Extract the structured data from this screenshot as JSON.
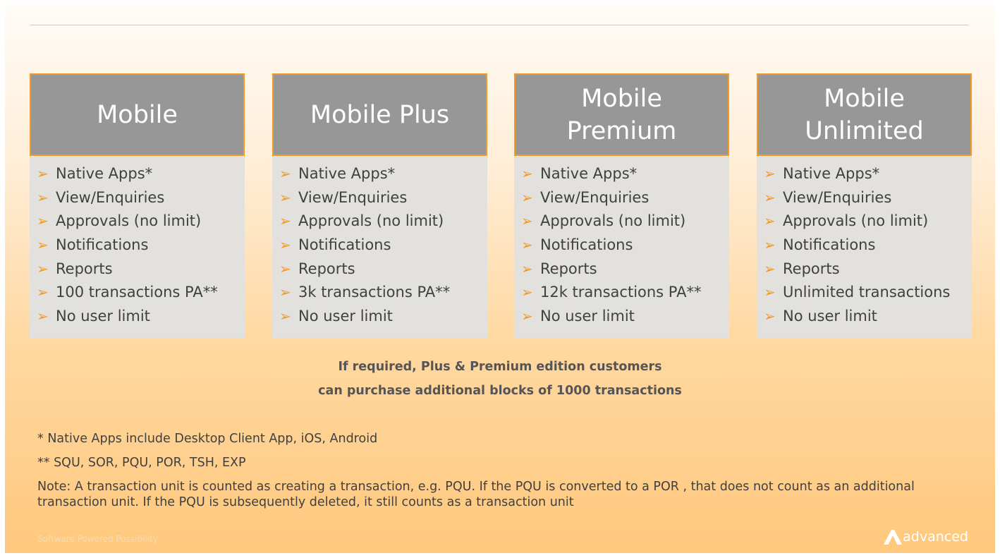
{
  "plans": [
    {
      "title": "Mobile",
      "features": [
        "Native Apps*",
        "View/Enquiries",
        "Approvals (no limit)",
        "Notifications",
        "Reports",
        "100 transactions PA**",
        "No user limit"
      ]
    },
    {
      "title": "Mobile Plus",
      "features": [
        "Native Apps*",
        "View/Enquiries",
        "Approvals (no limit)",
        "Notifications",
        "Reports",
        "3k transactions PA**",
        "No user limit"
      ]
    },
    {
      "title": "Mobile Premium",
      "features": [
        "Native Apps*",
        "View/Enquiries",
        "Approvals (no limit)",
        "Notifications",
        "Reports",
        "12k transactions PA**",
        "No user limit"
      ]
    },
    {
      "title": "Mobile Unlimited",
      "features": [
        "Native Apps*",
        "View/Enquiries",
        "Approvals (no limit)",
        "Notifications",
        "Reports",
        "Unlimited transactions",
        "No user limit"
      ]
    }
  ],
  "bullet_icon": "arrow-bullet-icon",
  "callout": {
    "line1": "If required, Plus & Premium edition customers",
    "line2": "can purchase additional blocks of 1000 transactions"
  },
  "footnotes": {
    "native_apps": "* Native Apps include Desktop Client App, iOS, Android",
    "transaction_types": "** SQU, SOR, PQU, POR, TSH, EXP",
    "note": "Note: A transaction unit is counted as creating a transaction, e.g. PQU. If the PQU is converted to a POR , that does not count as an additional transaction unit. If the PQU is subsequently deleted, it still counts as a transaction unit"
  },
  "footer": {
    "tagline": "Software Powered Possibility",
    "brand": "advanced",
    "brand_icon": "advanced-logo-icon"
  },
  "colors": {
    "accent": "#f29a26",
    "header_bg": "#979797",
    "card_bg": "#e3e1de",
    "text": "#404040"
  }
}
